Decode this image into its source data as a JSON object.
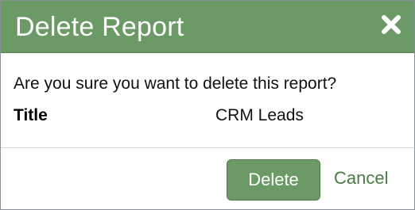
{
  "dialog": {
    "title": "Delete Report",
    "close_icon": "close-icon",
    "question": "Are you sure you want to delete this report?",
    "detail": {
      "label": "Title",
      "value": "CRM Leads"
    },
    "buttons": {
      "delete_label": "Delete",
      "cancel_label": "Cancel"
    }
  },
  "colors": {
    "header_bg": "#6b9a66",
    "button_bg": "#6b9a66",
    "link": "#4b7b46"
  }
}
